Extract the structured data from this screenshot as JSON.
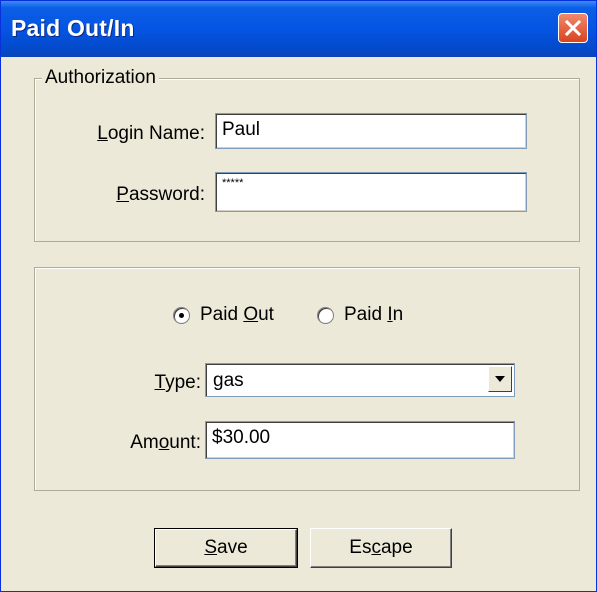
{
  "window": {
    "title": "Paid Out/In"
  },
  "authorization": {
    "legend": "Authorization",
    "login_label_ul": "L",
    "login_label_rest": "ogin Name:",
    "login_value": "Paul",
    "password_label_ul": "P",
    "password_label_rest": "assword:",
    "password_value": "*****"
  },
  "transaction": {
    "paid_out": {
      "label_pre": "Paid ",
      "label_ul": "O",
      "label_post": "ut",
      "selected": true
    },
    "paid_in": {
      "label_pre": "Paid ",
      "label_ul": "I",
      "label_post": "n",
      "selected": false
    },
    "type_label_ul": "T",
    "type_label_rest": "ype:",
    "type_value": "gas",
    "amount_label_pre": "Am",
    "amount_label_ul": "o",
    "amount_label_post": "unt:",
    "amount_value": "$30.00"
  },
  "buttons": {
    "save_ul": "S",
    "save_rest": "ave",
    "escape_pre": "Es",
    "escape_ul": "c",
    "escape_post": "ape"
  },
  "icons": {
    "close": "close-icon",
    "dropdown": "chevron-down-icon"
  },
  "colors": {
    "titlebar": "#0554e3",
    "close_button": "#d9431f",
    "dialog_face": "#ece9d8"
  }
}
